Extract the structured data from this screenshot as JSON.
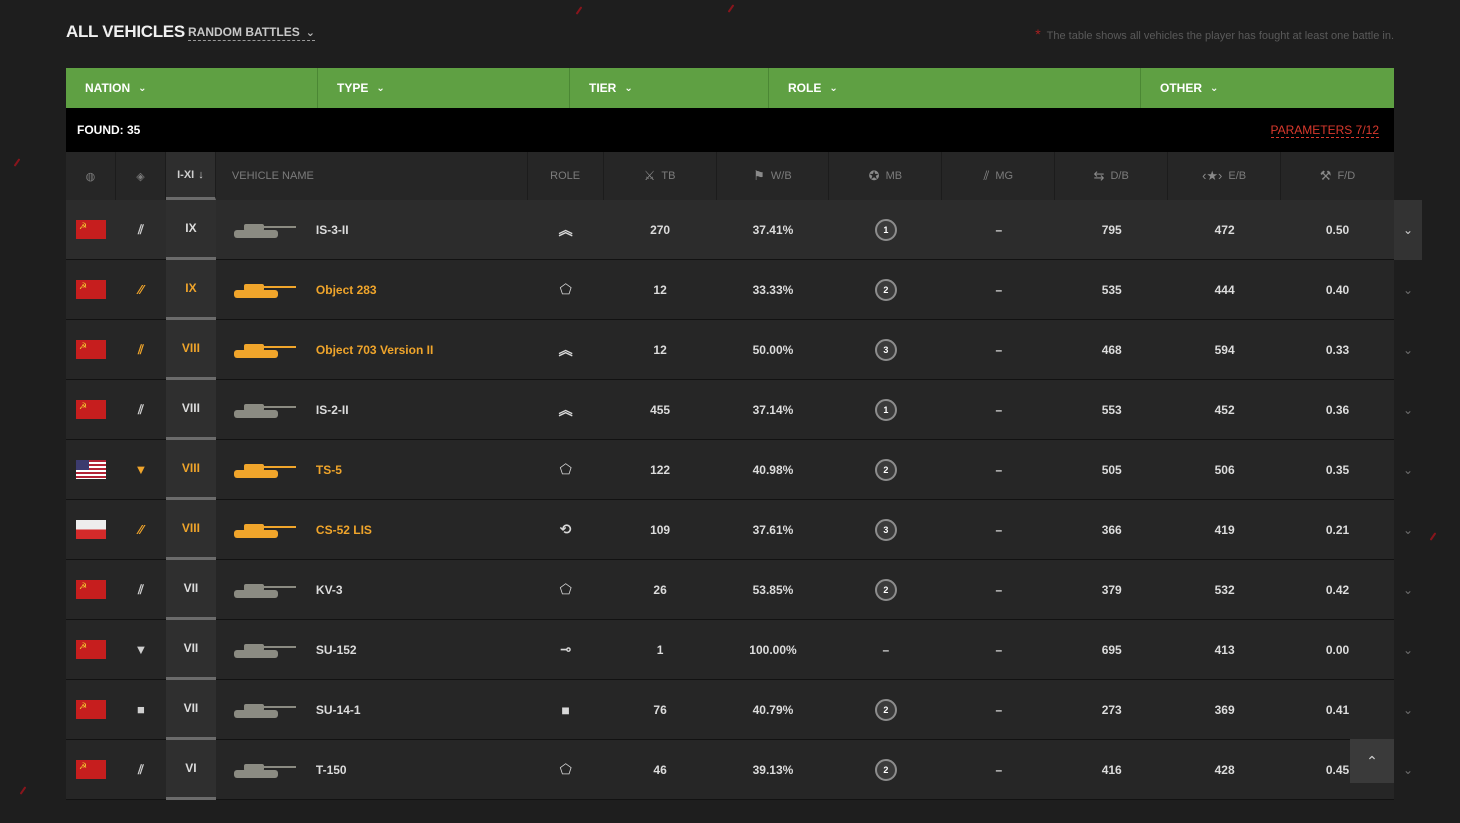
{
  "header": {
    "title": "ALL VEHICLES",
    "mode": "RANDOM BATTLES",
    "note_star": "*",
    "note": "The table shows all vehicles the player has fought at least one battle in."
  },
  "filters": [
    {
      "label": "NATION"
    },
    {
      "label": "TYPE"
    },
    {
      "label": "TIER"
    },
    {
      "label": "ROLE"
    },
    {
      "label": "OTHER"
    }
  ],
  "found": "FOUND: 35",
  "parameters": "PARAMETERS 7/12",
  "columns": {
    "tier": "I-XI",
    "name": "VEHICLE NAME",
    "role": "ROLE",
    "tb": "TB",
    "wb": "W/B",
    "mb": "MB",
    "mg": "MG",
    "db": "D/B",
    "eb": "E/B",
    "fd": "F/D"
  },
  "colors": {
    "accent_green": "#5fa043",
    "premium": "#f0a52b",
    "link_red": "#d9392d"
  },
  "rows": [
    {
      "nation": "ussr",
      "cls": "heavy-tank-icon",
      "premium": false,
      "tier": "IX",
      "name": "IS-3-II",
      "role": "assault-role-icon",
      "tb": "270",
      "wb": "37.41%",
      "mb": "1",
      "mg": "–",
      "db": "795",
      "eb": "472",
      "fd": "0.50"
    },
    {
      "nation": "ussr",
      "cls": "medium-tank-icon",
      "premium": true,
      "tier": "IX",
      "name": "Object 283",
      "role": "versatile-role-icon",
      "tb": "12",
      "wb": "33.33%",
      "mb": "2",
      "mg": "–",
      "db": "535",
      "eb": "444",
      "fd": "0.40"
    },
    {
      "nation": "ussr",
      "cls": "heavy-tank-icon",
      "premium": true,
      "tier": "VIII",
      "name": "Object 703 Version II",
      "role": "assault-role-icon",
      "tb": "12",
      "wb": "50.00%",
      "mb": "3",
      "mg": "–",
      "db": "468",
      "eb": "594",
      "fd": "0.33"
    },
    {
      "nation": "ussr",
      "cls": "heavy-tank-icon",
      "premium": false,
      "tier": "VIII",
      "name": "IS-2-II",
      "role": "assault-role-icon",
      "tb": "455",
      "wb": "37.14%",
      "mb": "1",
      "mg": "–",
      "db": "553",
      "eb": "452",
      "fd": "0.36"
    },
    {
      "nation": "usa",
      "cls": "td-icon",
      "premium": true,
      "tier": "VIII",
      "name": "TS-5",
      "role": "versatile-role-icon",
      "tb": "122",
      "wb": "40.98%",
      "mb": "2",
      "mg": "–",
      "db": "505",
      "eb": "506",
      "fd": "0.35"
    },
    {
      "nation": "pol",
      "cls": "medium-tank-icon",
      "premium": true,
      "tier": "VIII",
      "name": "CS-52 LIS",
      "role": "support-role-icon",
      "tb": "109",
      "wb": "37.61%",
      "mb": "3",
      "mg": "–",
      "db": "366",
      "eb": "419",
      "fd": "0.21"
    },
    {
      "nation": "ussr",
      "cls": "heavy-tank-icon",
      "premium": false,
      "tier": "VII",
      "name": "KV-3",
      "role": "versatile-role-icon",
      "tb": "26",
      "wb": "53.85%",
      "mb": "2",
      "mg": "–",
      "db": "379",
      "eb": "532",
      "fd": "0.42"
    },
    {
      "nation": "ussr",
      "cls": "td-icon",
      "premium": false,
      "tier": "VII",
      "name": "SU-152",
      "role": "sniper-role-icon",
      "tb": "1",
      "wb": "100.00%",
      "mb": "–",
      "mg": "–",
      "db": "695",
      "eb": "413",
      "fd": "0.00"
    },
    {
      "nation": "ussr",
      "cls": "spg-icon",
      "premium": false,
      "tier": "VII",
      "name": "SU-14-1",
      "role": "artillery-role-icon",
      "tb": "76",
      "wb": "40.79%",
      "mb": "2",
      "mg": "–",
      "db": "273",
      "eb": "369",
      "fd": "0.41"
    },
    {
      "nation": "ussr",
      "cls": "heavy-tank-icon",
      "premium": false,
      "tier": "VI",
      "name": "T-150",
      "role": "versatile-role-icon",
      "tb": "46",
      "wb": "39.13%",
      "mb": "2",
      "mg": "–",
      "db": "416",
      "eb": "428",
      "fd": "0.45"
    }
  ]
}
